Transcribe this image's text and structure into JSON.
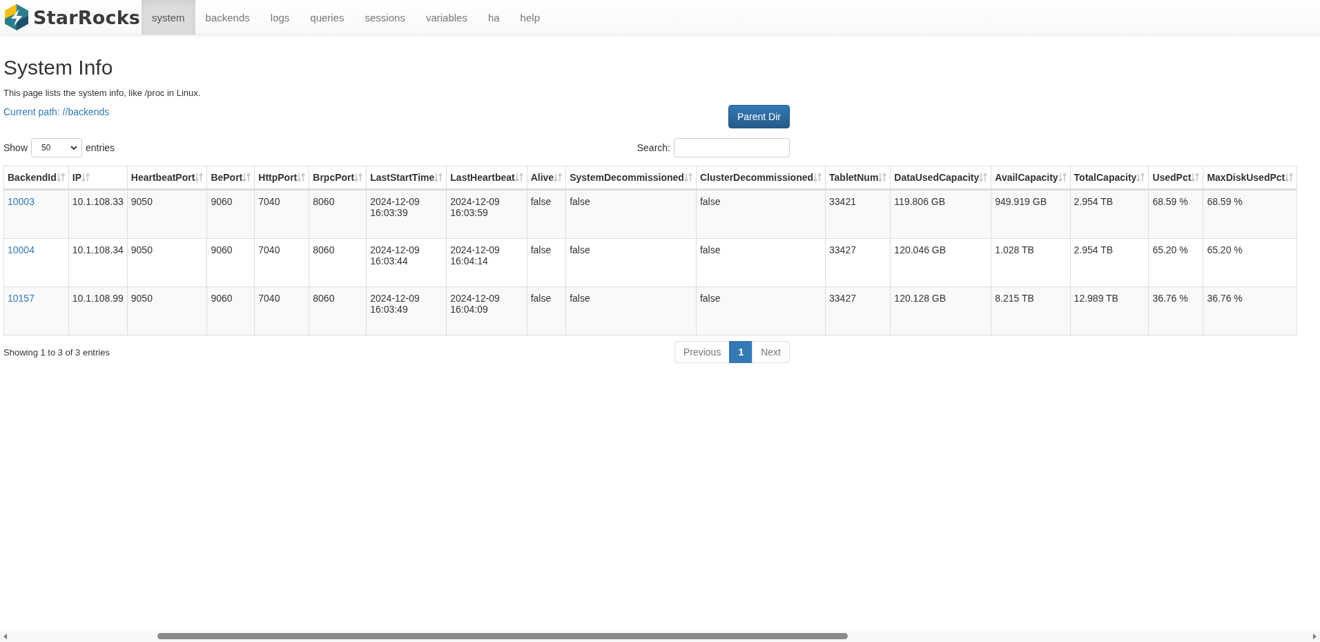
{
  "brand": {
    "name": "StarRocks"
  },
  "nav": [
    {
      "label": "system",
      "selected": true
    },
    {
      "label": "backends",
      "selected": false
    },
    {
      "label": "logs",
      "selected": false
    },
    {
      "label": "queries",
      "selected": false
    },
    {
      "label": "sessions",
      "selected": false
    },
    {
      "label": "variables",
      "selected": false
    },
    {
      "label": "ha",
      "selected": false
    },
    {
      "label": "help",
      "selected": false
    }
  ],
  "page": {
    "title": "System Info",
    "description": "This page lists the system info, like /proc in Linux.",
    "current_path": "Current path: //backends",
    "parent_button": "Parent Dir"
  },
  "length_control": {
    "before": "Show",
    "value": "50",
    "after": "entries"
  },
  "search": {
    "label": "Search:"
  },
  "table": {
    "columns": [
      {
        "label": "BackendId",
        "kind": "link"
      },
      {
        "label": "IP",
        "kind": "text"
      },
      {
        "label": "HeartbeatPort",
        "kind": "text"
      },
      {
        "label": "BePort",
        "kind": "text"
      },
      {
        "label": "HttpPort",
        "kind": "text"
      },
      {
        "label": "BrpcPort",
        "kind": "text"
      },
      {
        "label": "LastStartTime",
        "kind": "text"
      },
      {
        "label": "LastHeartbeat",
        "kind": "text"
      },
      {
        "label": "Alive",
        "kind": "text"
      },
      {
        "label": "SystemDecommissioned",
        "kind": "text"
      },
      {
        "label": "ClusterDecommissioned",
        "kind": "text"
      },
      {
        "label": "TabletNum",
        "kind": "text"
      },
      {
        "label": "DataUsedCapacity",
        "kind": "text"
      },
      {
        "label": "AvailCapacity",
        "kind": "text"
      },
      {
        "label": "TotalCapacity",
        "kind": "text"
      },
      {
        "label": "UsedPct",
        "kind": "text"
      },
      {
        "label": "MaxDiskUsedPct",
        "kind": "text"
      }
    ],
    "rows": [
      [
        "10003",
        "10.1.108.33",
        "9050",
        "9060",
        "7040",
        "8060",
        "2024-12-09 16:03:39",
        "2024-12-09 16:03:59",
        "false",
        "false",
        "false",
        "33421",
        "119.806 GB",
        "949.919 GB",
        "2.954 TB",
        "68.59 %",
        "68.59 %"
      ],
      [
        "10004",
        "10.1.108.34",
        "9050",
        "9060",
        "7040",
        "8060",
        "2024-12-09 16:03:44",
        "2024-12-09 16:04:14",
        "false",
        "false",
        "false",
        "33427",
        "120.046 GB",
        "1.028 TB",
        "2.954 TB",
        "65.20 %",
        "65.20 %"
      ],
      [
        "10157",
        "10.1.108.99",
        "9050",
        "9060",
        "7040",
        "8060",
        "2024-12-09 16:03:49",
        "2024-12-09 16:04:09",
        "false",
        "false",
        "false",
        "33427",
        "120.128 GB",
        "8.215 TB",
        "12.989 TB",
        "36.76 %",
        "36.76 %"
      ]
    ]
  },
  "info": "Showing 1 to 3 of 3 entries",
  "pagination": {
    "previous": "Previous",
    "pages": [
      {
        "label": "1",
        "selected": true
      }
    ],
    "next": "Next"
  }
}
